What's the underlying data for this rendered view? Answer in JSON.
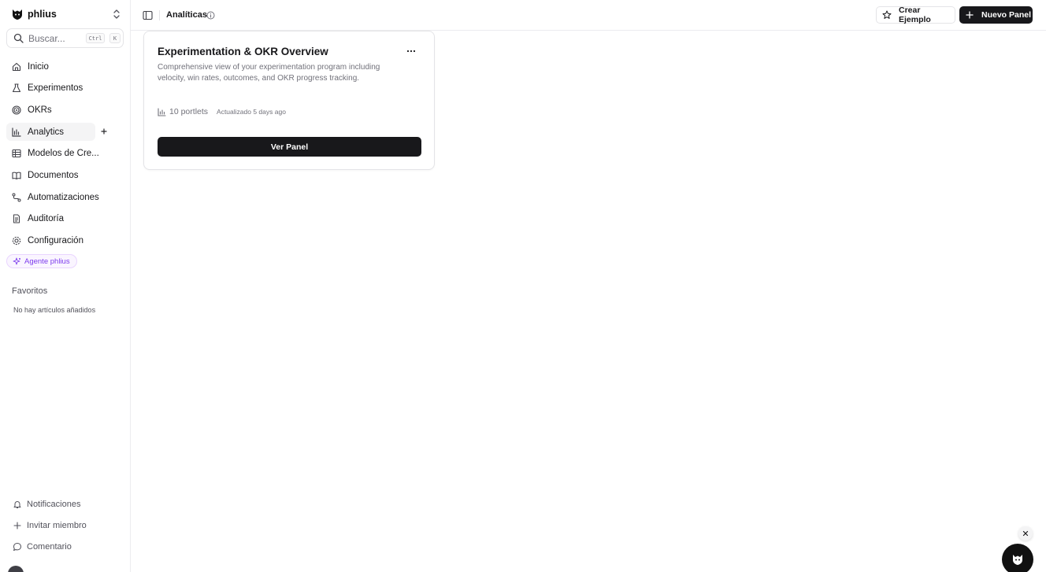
{
  "brand": {
    "name": "phlius"
  },
  "search": {
    "placeholder": "Buscar...",
    "shortcut_mod": "Ctrl",
    "shortcut_key": "K"
  },
  "nav": [
    {
      "label": "Inicio",
      "icon": "home-icon"
    },
    {
      "label": "Experimentos",
      "icon": "flask-icon"
    },
    {
      "label": "OKRs",
      "icon": "target-icon"
    },
    {
      "label": "Analytics",
      "icon": "bar-chart-icon",
      "active": true
    },
    {
      "label": "Modelos de Cre...",
      "icon": "table-icon"
    },
    {
      "label": "Documentos",
      "icon": "book-icon"
    },
    {
      "label": "Automatizaciones",
      "icon": "workflow-icon"
    },
    {
      "label": "Auditoría",
      "icon": "file-icon"
    },
    {
      "label": "Configuración",
      "icon": "gear-icon"
    }
  ],
  "agent": {
    "label": "Agente phlius"
  },
  "favorites": {
    "title": "Favoritos",
    "empty": "No hay artículos añadidos"
  },
  "bottom": {
    "notifications": "Notificaciones",
    "invite": "Invitar miembro",
    "comment": "Comentario"
  },
  "header": {
    "title": "Analíticas",
    "create_example": "Crear Ejemplo",
    "new_panel": "Nuevo Panel"
  },
  "card": {
    "title": "Experimentation & OKR Overview",
    "description": "Comprehensive view of your experimentation program including velocity, win rates, outcomes, and OKR progress tracking.",
    "portlets": "10 portlets",
    "updated": "Actualizado 5 days ago",
    "button": "Ver Panel"
  },
  "colors": {
    "accent_dark": "#18181b",
    "agent_purple": "#7c3aed"
  }
}
